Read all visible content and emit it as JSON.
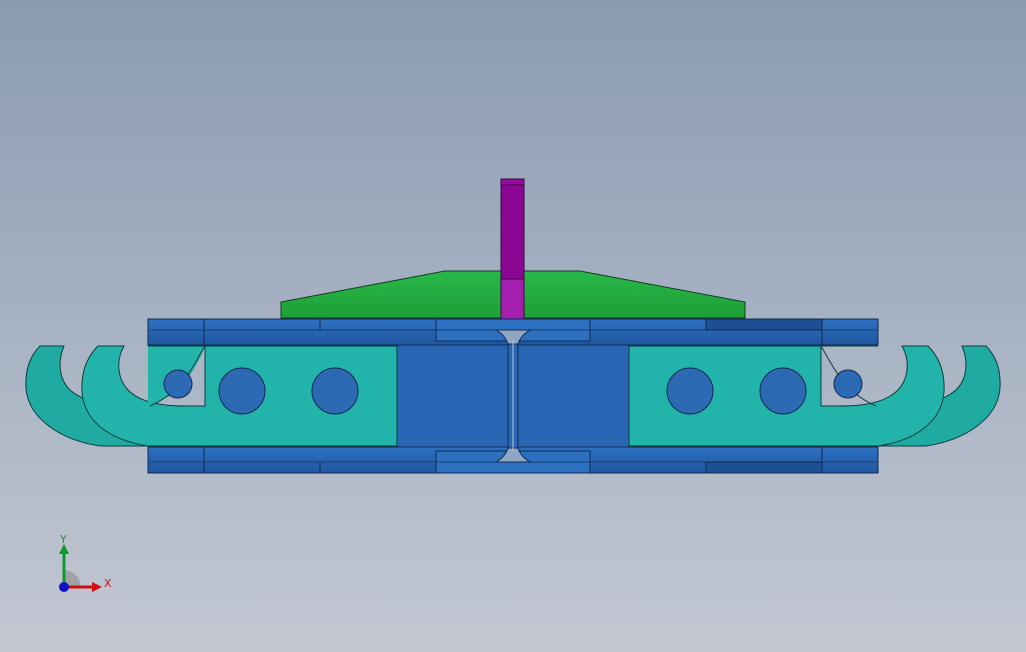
{
  "viewport": {
    "background_top": "#8a9bb1",
    "background_bottom": "#c3c8d2"
  },
  "model": {
    "colors": {
      "rail_blue": "#2a66b4",
      "rail_dark": "#1c4f94",
      "plate_teal": "#22b3aa",
      "hook_teal": "#1faaa2",
      "wedge_green": "#22ad3e",
      "post_purple": "#8a0794",
      "post_light": "#a51fae",
      "hole_blue": "#2c6ab4"
    }
  },
  "triad": {
    "x_label": "X",
    "y_label": "Y",
    "x_color": "#d01010",
    "y_color": "#0c9c2c",
    "z_color": "#1010c8"
  }
}
